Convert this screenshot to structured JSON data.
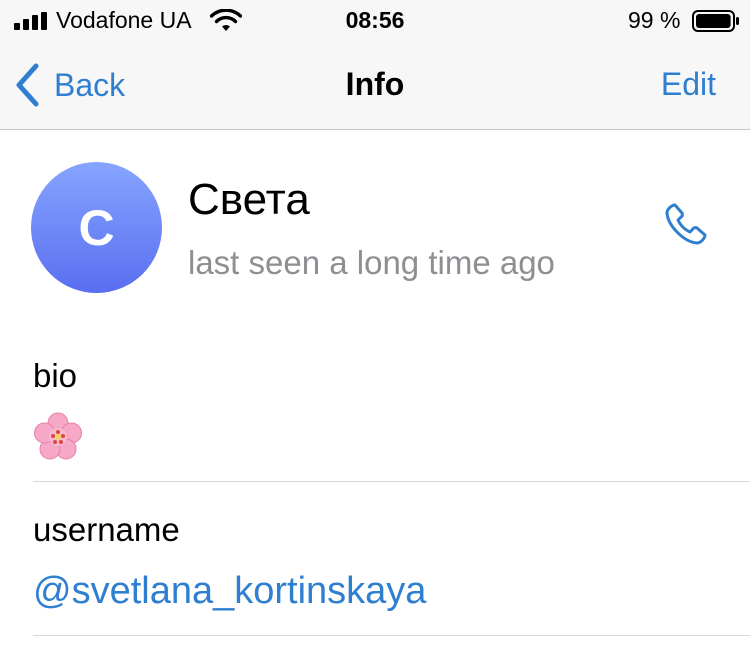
{
  "status_bar": {
    "carrier": "Vodafone UA",
    "time": "08:56",
    "battery_percent": "99 %",
    "battery_level": 0.99,
    "icons": [
      "signal-icon",
      "wifi-icon",
      "battery-icon"
    ]
  },
  "nav": {
    "back_label": "Back",
    "title": "Info",
    "edit_label": "Edit"
  },
  "profile": {
    "avatar_initial": "C",
    "name": "Света",
    "status": "last seen a long time ago",
    "avatar_gradient": [
      "#86a5ff",
      "#5a6ef0"
    ]
  },
  "bio": {
    "label": "bio",
    "value": "🌸"
  },
  "username": {
    "label": "username",
    "value": "@svetlana_kortinskaya"
  },
  "colors": {
    "accent": "#2f7fd1",
    "secondary_text": "#8e8e93",
    "nav_background": "#f7f7f7"
  }
}
